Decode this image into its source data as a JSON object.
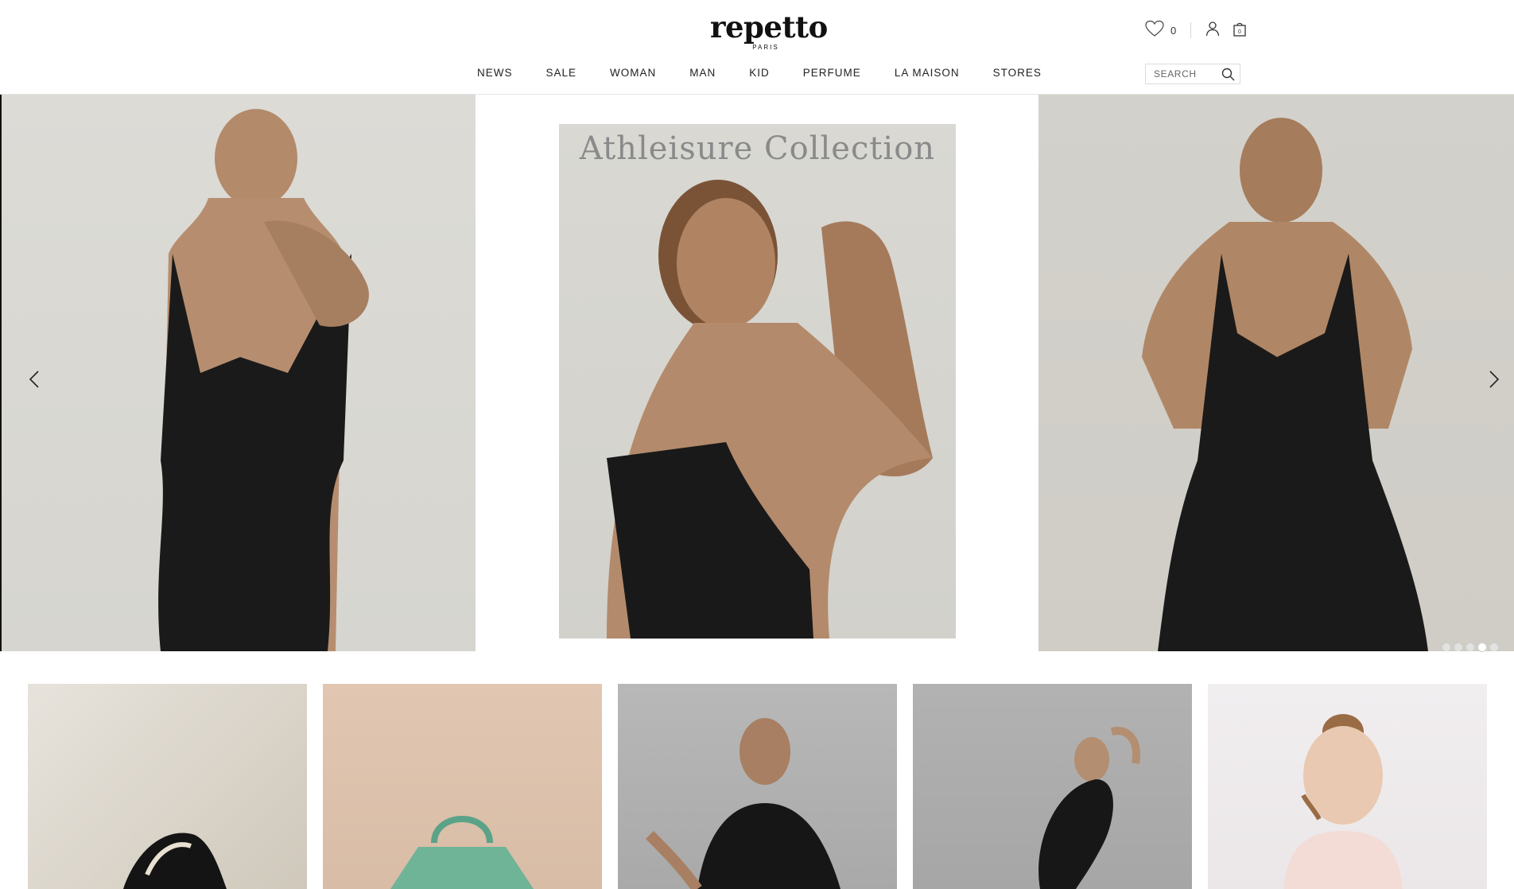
{
  "brand": {
    "name": "repetto",
    "sub": "PARIS"
  },
  "utilities": {
    "wishlist_count": "0"
  },
  "nav": {
    "items": [
      {
        "label": "NEWS"
      },
      {
        "label": "SALE"
      },
      {
        "label": "WOMAN"
      },
      {
        "label": "MAN"
      },
      {
        "label": "KID"
      },
      {
        "label": "PERFUME"
      },
      {
        "label": "LA MAISON"
      },
      {
        "label": "STORES"
      }
    ]
  },
  "search": {
    "placeholder": "SEARCH"
  },
  "hero": {
    "title": "Athleisure Collection",
    "slide_count": 5,
    "active_slide": 4
  },
  "colors": {
    "text": "#222222",
    "hero_title": "#8a8a8a",
    "divider": "#e6e6e6"
  },
  "icons": {
    "wishlist": "heart-icon",
    "account": "user-icon",
    "cart": "bag-icon",
    "search": "search-icon",
    "prev": "chevron-left-icon",
    "next": "chevron-right-icon"
  }
}
